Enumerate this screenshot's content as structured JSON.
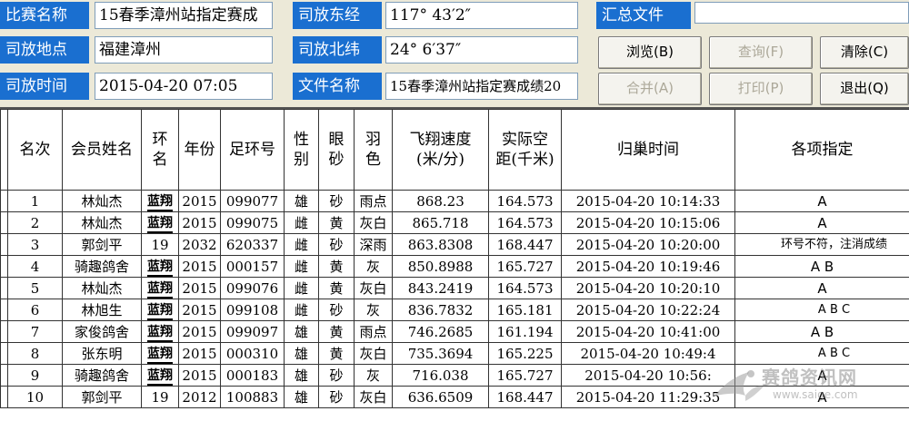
{
  "header": {
    "race_name_label": "比赛名称",
    "race_name_value": "15春季漳州站指定赛成",
    "release_place_label": "司放地点",
    "release_place_value": "福建漳州",
    "release_time_label": "司放时间",
    "release_time_value": "2015-04-20 07:05",
    "longitude_label": "司放东经",
    "longitude_value": "117° 43′2″",
    "latitude_label": "司放北纬",
    "latitude_value": "24° 6′37″",
    "file_name_label": "文件名称",
    "file_name_value": "15春季漳州站指定赛成绩20",
    "summary_file_label": "汇总文件",
    "summary_file_value": ""
  },
  "buttons": {
    "browse": "浏览(B)",
    "query": "查询(F)",
    "clear": "清除(C)",
    "merge": "合并(A)",
    "print": "打印(P)",
    "exit": "退出(Q)"
  },
  "table": {
    "headers": {
      "rank": "名次",
      "member": "会员姓名",
      "ring": "环名",
      "year": "年份",
      "foot_ring": "足环号",
      "sex": "性别",
      "eye": "眼砂",
      "feather": "羽色",
      "speed": "飞翔速度(米/分)",
      "distance": "实际空距(千米)",
      "arrival": "归巢时间",
      "designated": "各项指定"
    },
    "rows": [
      {
        "rank": "1",
        "member": "林灿杰",
        "ring": "蓝翔",
        "year": "2015",
        "foot_ring": "099077",
        "sex": "雄",
        "eye": "砂",
        "feather": "雨点",
        "speed": "868.23",
        "distance": "164.573",
        "arrival": "2015-04-20  10:14:33",
        "designated": "A"
      },
      {
        "rank": "2",
        "member": "林灿杰",
        "ring": "蓝翔",
        "year": "2015",
        "foot_ring": "099075",
        "sex": "雌",
        "eye": "黄",
        "feather": "灰白",
        "speed": "865.718",
        "distance": "164.573",
        "arrival": "2015-04-20  10:15:06",
        "designated": "A"
      },
      {
        "rank": "3",
        "member": "郭剑平",
        "ring": "19",
        "year": "2032",
        "foot_ring": "620337",
        "sex": "雌",
        "eye": "砂",
        "feather": "深雨",
        "speed": "863.8308",
        "distance": "168.447",
        "arrival": "2015-04-20  10:20:00",
        "designated": "环号不符，注消成绩"
      },
      {
        "rank": "4",
        "member": "骑趣鸽舍",
        "ring": "蓝翔",
        "year": "2015",
        "foot_ring": "000157",
        "sex": "雌",
        "eye": "黄",
        "feather": "灰",
        "speed": "850.8988",
        "distance": "165.727",
        "arrival": "2015-04-20  10:19:46",
        "designated": "A   B"
      },
      {
        "rank": "5",
        "member": "林灿杰",
        "ring": "蓝翔",
        "year": "2015",
        "foot_ring": "099076",
        "sex": "雌",
        "eye": "黄",
        "feather": "灰白",
        "speed": "843.2419",
        "distance": "164.573",
        "arrival": "2015-04-20  10:20:10",
        "designated": "A"
      },
      {
        "rank": "6",
        "member": "林旭生",
        "ring": "蓝翔",
        "year": "2015",
        "foot_ring": "099108",
        "sex": "雌",
        "eye": "砂",
        "feather": "灰",
        "speed": "836.7832",
        "distance": "165.181",
        "arrival": "2015-04-20  10:22:24",
        "designated": "A   B   C"
      },
      {
        "rank": "7",
        "member": "家俊鸽舍",
        "ring": "蓝翔",
        "year": "2015",
        "foot_ring": "099097",
        "sex": "雄",
        "eye": "黄",
        "feather": "雨点",
        "speed": "746.2685",
        "distance": "161.194",
        "arrival": "2015-04-20  10:41:00",
        "designated": "A   B"
      },
      {
        "rank": "8",
        "member": "张东明",
        "ring": "蓝翔",
        "year": "2015",
        "foot_ring": "000310",
        "sex": "雄",
        "eye": "黄",
        "feather": "灰白",
        "speed": "735.3694",
        "distance": "165.225",
        "arrival": "2015-04-20  10:49:4",
        "designated": "A   B   C"
      },
      {
        "rank": "9",
        "member": "骑趣鸽舍",
        "ring": "蓝翔",
        "year": "2015",
        "foot_ring": "000183",
        "sex": "雄",
        "eye": "砂",
        "feather": "灰",
        "speed": "716.038",
        "distance": "165.727",
        "arrival": "2015-04-20  10:56:",
        "designated": "A"
      },
      {
        "rank": "10",
        "member": "郭剑平",
        "ring": "19",
        "year": "2012",
        "foot_ring": "100883",
        "sex": "雄",
        "eye": "砂",
        "feather": "灰白",
        "speed": "636.6509",
        "distance": "168.447",
        "arrival": "2015-04-20  11:29:35",
        "designated": "A"
      }
    ]
  },
  "watermark": {
    "text": "赛鸽资讯网",
    "url": "www.saige.com"
  },
  "colors": {
    "label_bg": "#1a6fd0",
    "window_bg": "#ece9d8"
  }
}
